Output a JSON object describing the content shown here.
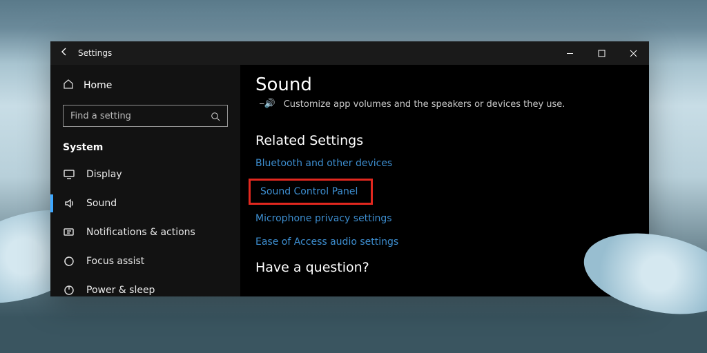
{
  "window": {
    "title": "Settings",
    "controls": {
      "minimize": "minimize",
      "maximize": "maximize",
      "close": "close"
    }
  },
  "sidebar": {
    "home": "Home",
    "search_placeholder": "Find a setting",
    "category": "System",
    "items": [
      {
        "icon": "display",
        "label": "Display"
      },
      {
        "icon": "sound",
        "label": "Sound",
        "active": true
      },
      {
        "icon": "notify",
        "label": "Notifications & actions"
      },
      {
        "icon": "focus",
        "label": "Focus assist"
      },
      {
        "icon": "power",
        "label": "Power & sleep"
      }
    ]
  },
  "main": {
    "title": "Sound",
    "volume_caption": "Customize app volumes and the speakers or devices they use.",
    "related_heading": "Related Settings",
    "links": [
      "Bluetooth and other devices",
      "Sound Control Panel",
      "Microphone privacy settings",
      "Ease of Access audio settings"
    ],
    "highlighted_link_index": 1,
    "question_heading": "Have a question?"
  }
}
